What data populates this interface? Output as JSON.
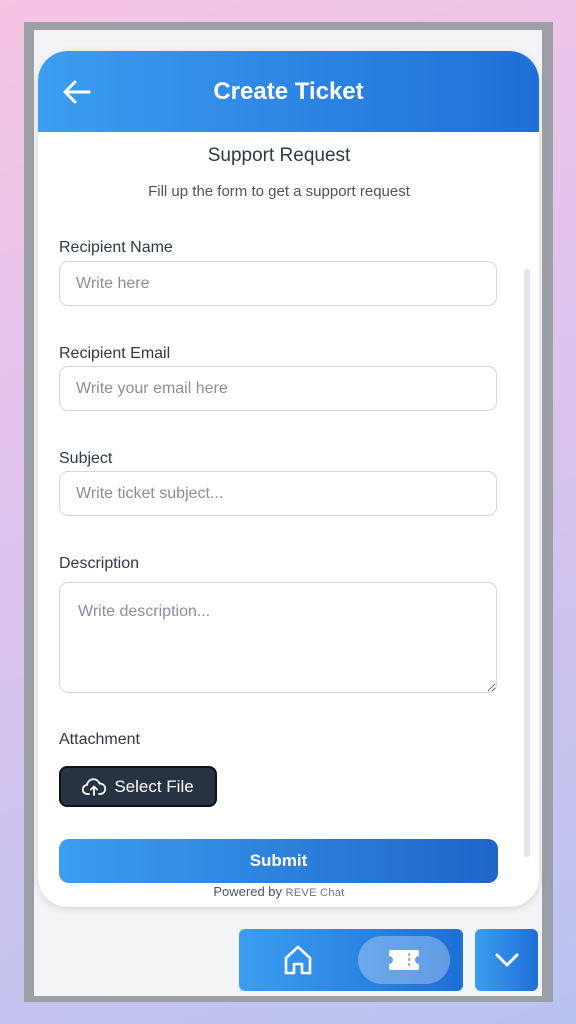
{
  "header": {
    "title": "Create Ticket",
    "back_icon": "arrow-left-icon"
  },
  "form": {
    "heading": "Support Request",
    "subtitle": "Fill up the form to get a support request",
    "fields": {
      "name": {
        "label": "Recipient Name",
        "placeholder": "Write here",
        "value": ""
      },
      "email": {
        "label": "Recipient Email",
        "placeholder": "Write your email here",
        "value": ""
      },
      "subject": {
        "label": "Subject",
        "placeholder": "Write ticket subject...",
        "value": ""
      },
      "description": {
        "label": "Description",
        "placeholder": "Write description...",
        "value": ""
      }
    },
    "attachment": {
      "label": "Attachment",
      "button_label": "Select File",
      "icon": "cloud-upload-icon"
    },
    "submit_label": "Submit",
    "powered_by": "Powered by",
    "brand": "REVE Chat"
  },
  "bottom_nav": {
    "home_icon": "home-icon",
    "ticket_icon": "ticket-icon",
    "collapse_icon": "chevron-down-icon"
  },
  "colors": {
    "accent_start": "#3b9ef0",
    "accent_end": "#1f6fd6",
    "dark_button": "#273342"
  }
}
